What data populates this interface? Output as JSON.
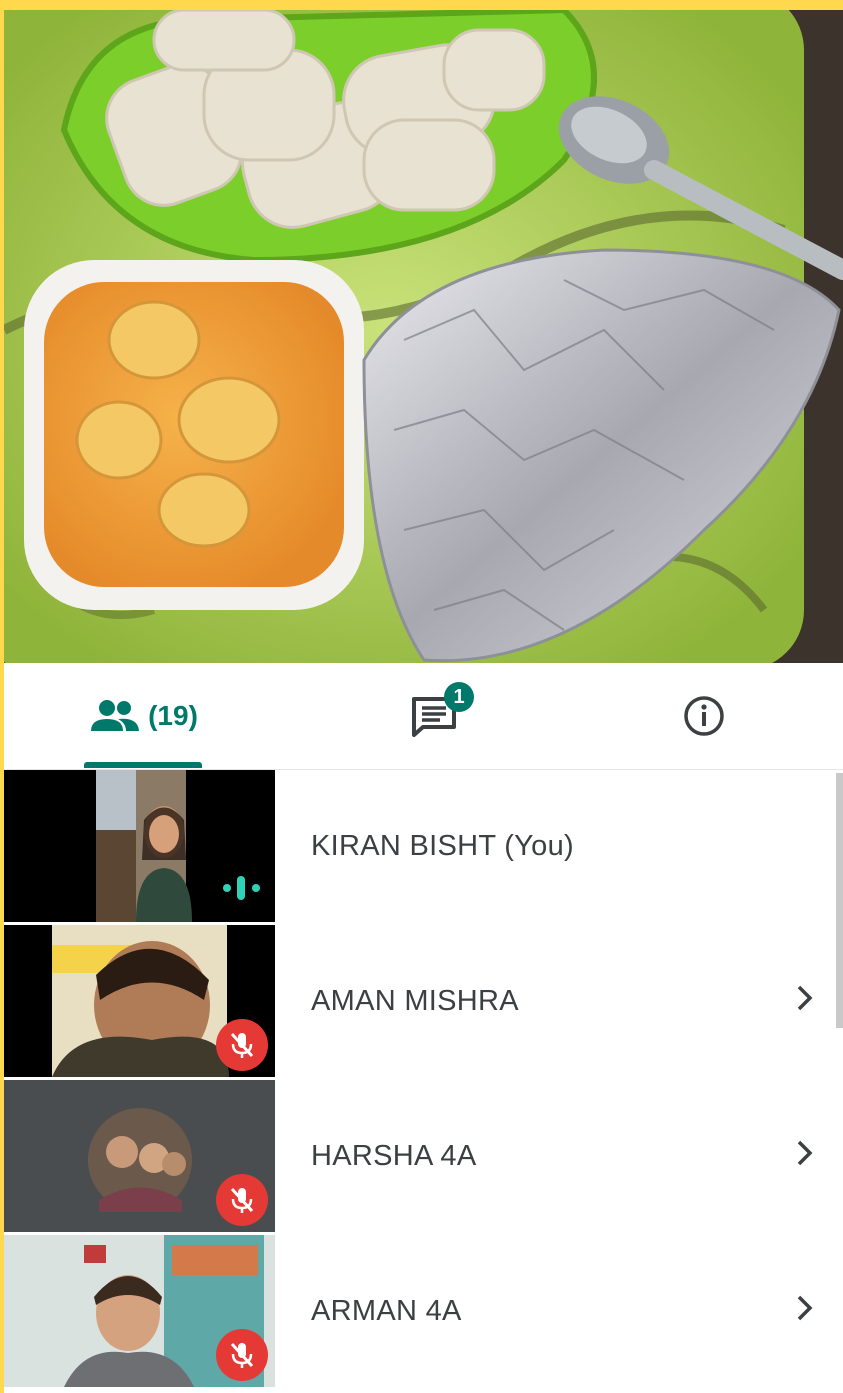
{
  "tabs": {
    "people_icon": "people-icon",
    "people_count": "(19)",
    "chat_icon": "chat-icon",
    "chat_badge": "1",
    "info_icon": "info-icon"
  },
  "participants": [
    {
      "name": "KIRAN BISHT (You)",
      "status": "speaking"
    },
    {
      "name": "AMAN MISHRA",
      "status": "muted"
    },
    {
      "name": "HARSHA 4A",
      "status": "muted"
    },
    {
      "name": "ARMAN 4A",
      "status": "muted"
    }
  ],
  "colors": {
    "accent": "#00796b",
    "mute_red": "#e53935",
    "speaking_teal": "#2ed3b7",
    "border_yellow": "#ffd84d"
  }
}
